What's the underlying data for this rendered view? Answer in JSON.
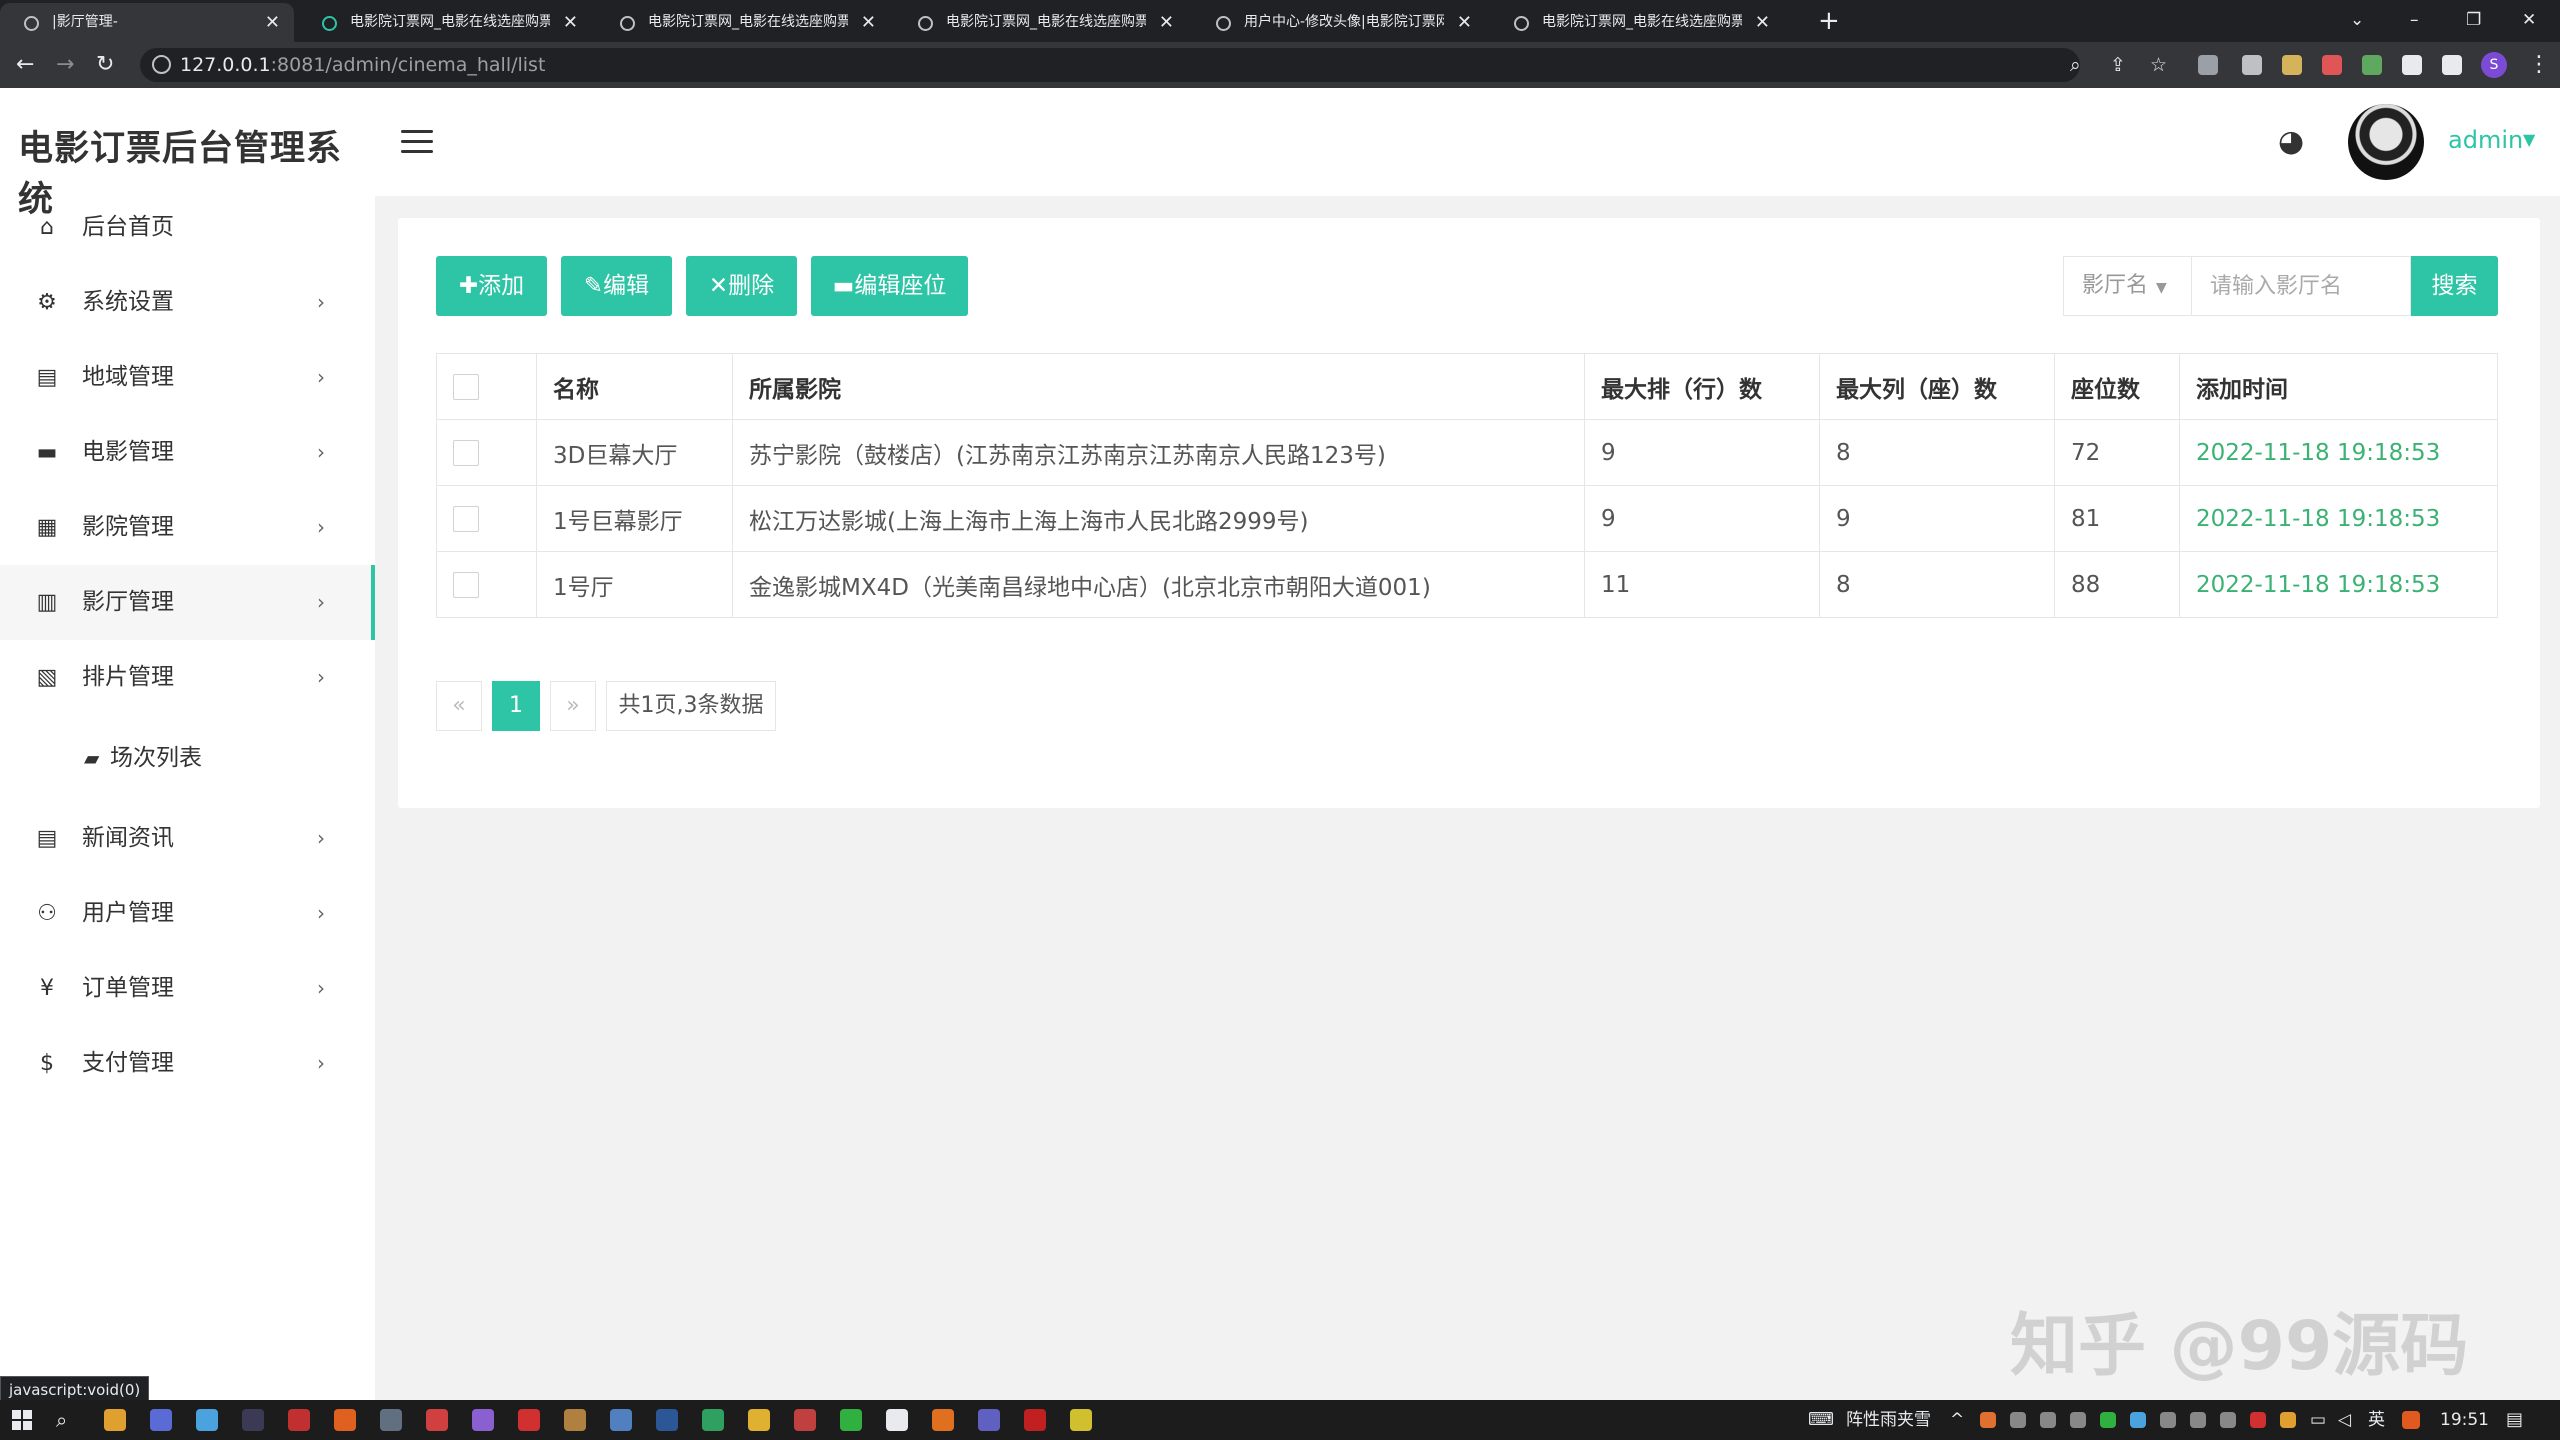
{
  "browser": {
    "tabs": [
      {
        "title": "|影厅管理-",
        "active": true
      },
      {
        "title": "电影院订票网_电影在线选座购票",
        "active": false
      },
      {
        "title": "电影院订票网_电影在线选座购票",
        "active": false
      },
      {
        "title": "电影院订票网_电影在线选座购票",
        "active": false
      },
      {
        "title": "用户中心-修改头像|电影院订票网",
        "active": false
      },
      {
        "title": "电影院订票网_电影在线选座购票",
        "active": false
      }
    ],
    "url_host": "127.0.0.1",
    "url_path": ":8081/admin/cinema_hall/list",
    "profile_initial": "S",
    "status_tip": "javascript:void(0)"
  },
  "app": {
    "title": "电影订票后台管理系统",
    "user": "admin",
    "accent_color": "#2ec4a6"
  },
  "sidebar": {
    "items": [
      {
        "label": "后台首页",
        "icon": "home-icon",
        "glyph": "⌂",
        "has_arrow": false
      },
      {
        "label": "系统设置",
        "icon": "gear-icon",
        "glyph": "⚙",
        "has_arrow": true
      },
      {
        "label": "地域管理",
        "icon": "map-icon",
        "glyph": "▤",
        "has_arrow": true
      },
      {
        "label": "电影管理",
        "icon": "film-icon",
        "glyph": "▬",
        "has_arrow": true
      },
      {
        "label": "影院管理",
        "icon": "cinema-icon",
        "glyph": "▦",
        "has_arrow": true
      },
      {
        "label": "影厅管理",
        "icon": "building-icon",
        "glyph": "▥",
        "has_arrow": true,
        "active": true
      },
      {
        "label": "排片管理",
        "icon": "schedule-icon",
        "glyph": "▧",
        "has_arrow": true
      }
    ],
    "subitem": {
      "label": "场次列表",
      "icon": "folder-icon",
      "glyph": "▰"
    },
    "items2": [
      {
        "label": "新闻资讯",
        "icon": "news-icon",
        "glyph": "▤",
        "has_arrow": true
      },
      {
        "label": "用户管理",
        "icon": "users-icon",
        "glyph": "⚇",
        "has_arrow": true
      },
      {
        "label": "订单管理",
        "icon": "yen-icon",
        "glyph": "¥",
        "has_arrow": true
      },
      {
        "label": "支付管理",
        "icon": "dollar-icon",
        "glyph": "$",
        "has_arrow": true
      }
    ]
  },
  "toolbar": {
    "add_label": "添加",
    "edit_label": "编辑",
    "delete_label": "删除",
    "edit_seat_label": "编辑座位",
    "search_field": "影厅名",
    "search_placeholder": "请输入影厅名",
    "search_label": "搜索"
  },
  "table": {
    "columns": [
      "名称",
      "所属影院",
      "最大排（行）数",
      "最大列（座）数",
      "座位数",
      "添加时间"
    ],
    "rows": [
      [
        "3D巨幕大厅",
        "苏宁影院（鼓楼店）(江苏南京江苏南京江苏南京人民路123号)",
        "9",
        "8",
        "72",
        "2022-11-18 19:18:53"
      ],
      [
        "1号巨幕影厅",
        "松江万达影城(上海上海市上海上海市人民北路2999号)",
        "9",
        "9",
        "81",
        "2022-11-18 19:18:53"
      ],
      [
        "1号厅",
        "金逸影城MX4D（光美南昌绿地中心店）(北京北京市朝阳大道001)",
        "11",
        "8",
        "88",
        "2022-11-18 19:18:53"
      ]
    ]
  },
  "pagination": {
    "prev": "«",
    "current": "1",
    "next": "»",
    "info": "共1页,3条数据"
  },
  "watermark": "知乎 @99源码",
  "taskbar": {
    "ime_text": "阵性雨夹雪",
    "lang": "英",
    "time": "19:51"
  }
}
